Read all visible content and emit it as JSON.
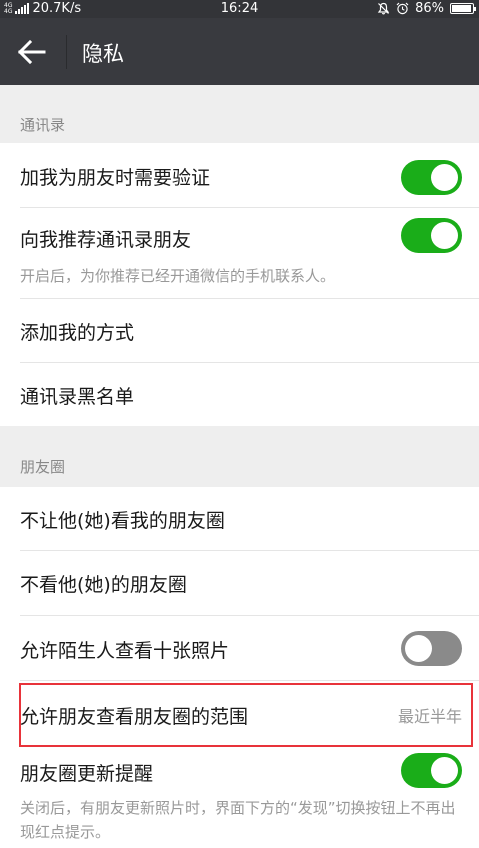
{
  "status_bar": {
    "network_type_top": "4G",
    "network_type_bottom": "4G",
    "speed": "20.7K/s",
    "time": "16:24",
    "battery": "86%",
    "battery_level": 0.86,
    "icons": [
      "signal-icon",
      "mute-icon",
      "alarm-icon",
      "battery-icon"
    ]
  },
  "header": {
    "back_icon": "arrow-left-icon",
    "title": "隐私"
  },
  "contacts_section": {
    "title": "通讯录",
    "require_verification": {
      "label": "加我为朋友时需要验证",
      "enabled": true
    },
    "recommend_contacts": {
      "label": "向我推荐通讯录朋友",
      "enabled": true,
      "hint": "开启后，为你推荐已经开通微信的手机联系人。"
    },
    "add_methods": {
      "label": "添加我的方式"
    },
    "blacklist": {
      "label": "通讯录黑名单"
    }
  },
  "moments_section": {
    "title": "朋友圈",
    "hide_my_moments": {
      "label": "不让他(她)看我的朋友圈"
    },
    "hide_their_moments": {
      "label": "不看他(她)的朋友圈"
    },
    "stranger_ten_photos": {
      "label": "允许陌生人查看十张照片",
      "enabled": false
    },
    "visible_range": {
      "label": "允许朋友查看朋友圈的范围",
      "value": "最近半年"
    },
    "update_reminder": {
      "label": "朋友圈更新提醒",
      "enabled": true,
      "hint": "关闭后，有朋友更新照片时，界面下方的“发现”切换按钮上不再出现红点提示。"
    }
  },
  "colors": {
    "toolbar": "#393a3f",
    "toggle_on": "#1aad19",
    "toggle_off": "#8a8a8a",
    "highlight": "#e8333a"
  }
}
